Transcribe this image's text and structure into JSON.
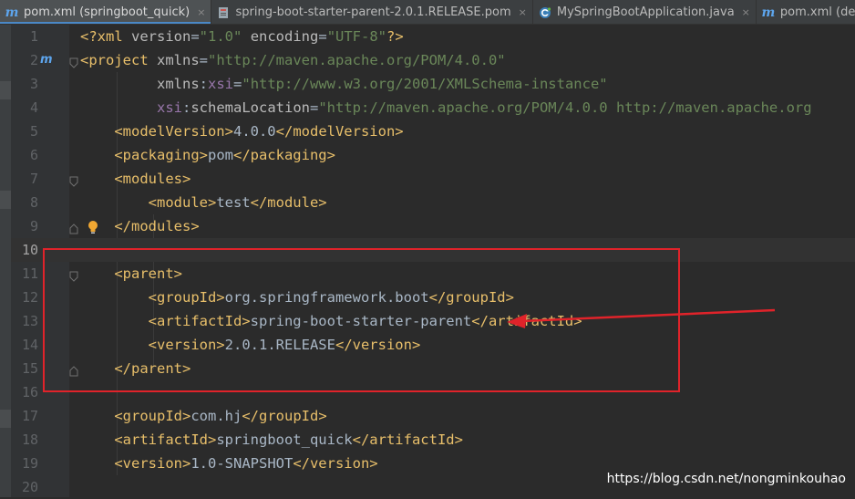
{
  "tabs": [
    {
      "label": "pom.xml (springboot_quick)",
      "icon": "maven-icon",
      "active": true
    },
    {
      "label": "spring-boot-starter-parent-2.0.1.RELEASE.pom",
      "icon": "jar-file-icon",
      "active": false
    },
    {
      "label": "MySpringBootApplication.java",
      "icon": "java-class-icon",
      "active": false
    },
    {
      "label": "pom.xml (demo)",
      "icon": "maven-icon",
      "active": false
    }
  ],
  "tab_close_glyph": "×",
  "gutter": {
    "maven_marker": "m",
    "icons": [
      "maven-icon",
      "fold-icon",
      "lightbulb-icon"
    ]
  },
  "editor": {
    "current_line": 10,
    "lines": [
      {
        "n": "1",
        "tokens": [
          [
            "tag",
            "<?xml "
          ],
          [
            "attr",
            "version"
          ],
          [
            "txt",
            "="
          ],
          [
            "str",
            "\"1.0\""
          ],
          [
            "txt",
            " "
          ],
          [
            "attr",
            "encoding"
          ],
          [
            "txt",
            "="
          ],
          [
            "str",
            "\"UTF-8\""
          ],
          [
            "tag",
            "?>"
          ]
        ]
      },
      {
        "n": "2",
        "tokens": [
          [
            "tag",
            "<project "
          ],
          [
            "attr",
            "xmlns"
          ],
          [
            "txt",
            "="
          ],
          [
            "str",
            "\"http://maven.apache.org/POM/4.0.0\""
          ]
        ]
      },
      {
        "n": "3",
        "tokens": [
          [
            "txt",
            "         "
          ],
          [
            "attr",
            "xmlns"
          ],
          [
            "txt",
            ":"
          ],
          [
            "ns",
            "xsi"
          ],
          [
            "txt",
            "="
          ],
          [
            "str",
            "\"http://www.w3.org/2001/XMLSchema-instance\""
          ]
        ]
      },
      {
        "n": "4",
        "tokens": [
          [
            "txt",
            "         "
          ],
          [
            "ns",
            "xsi"
          ],
          [
            "txt",
            ":"
          ],
          [
            "attr",
            "schemaLocation"
          ],
          [
            "txt",
            "="
          ],
          [
            "str",
            "\"http://maven.apache.org/POM/4.0.0 http://maven.apache.org"
          ]
        ]
      },
      {
        "n": "5",
        "tokens": [
          [
            "txt",
            "    "
          ],
          [
            "tag",
            "<modelVersion>"
          ],
          [
            "txt",
            "4.0.0"
          ],
          [
            "tag",
            "</modelVersion>"
          ]
        ]
      },
      {
        "n": "6",
        "tokens": [
          [
            "txt",
            "    "
          ],
          [
            "tag",
            "<packaging>"
          ],
          [
            "txt",
            "pom"
          ],
          [
            "tag",
            "</packaging>"
          ]
        ]
      },
      {
        "n": "7",
        "tokens": [
          [
            "txt",
            "    "
          ],
          [
            "tag",
            "<modules>"
          ]
        ]
      },
      {
        "n": "8",
        "tokens": [
          [
            "txt",
            "        "
          ],
          [
            "tag",
            "<module>"
          ],
          [
            "txt",
            "test"
          ],
          [
            "tag",
            "</module>"
          ]
        ]
      },
      {
        "n": "9",
        "tokens": [
          [
            "txt",
            "    "
          ],
          [
            "tag",
            "</modules>"
          ]
        ]
      },
      {
        "n": "10",
        "tokens": []
      },
      {
        "n": "11",
        "tokens": [
          [
            "txt",
            "    "
          ],
          [
            "tag",
            "<parent>"
          ]
        ]
      },
      {
        "n": "12",
        "tokens": [
          [
            "txt",
            "        "
          ],
          [
            "tag",
            "<groupId>"
          ],
          [
            "txt",
            "org.springframework.boot"
          ],
          [
            "tag",
            "</groupId>"
          ]
        ]
      },
      {
        "n": "13",
        "tokens": [
          [
            "txt",
            "        "
          ],
          [
            "tag",
            "<artifactId>"
          ],
          [
            "txt",
            "spring-boot-starter-parent"
          ],
          [
            "tag",
            "</artifactId>"
          ]
        ]
      },
      {
        "n": "14",
        "tokens": [
          [
            "txt",
            "        "
          ],
          [
            "tag",
            "<version>"
          ],
          [
            "txt",
            "2.0.1.RELEASE"
          ],
          [
            "tag",
            "</version>"
          ]
        ]
      },
      {
        "n": "15",
        "tokens": [
          [
            "txt",
            "    "
          ],
          [
            "tag",
            "</parent>"
          ]
        ]
      },
      {
        "n": "16",
        "tokens": []
      },
      {
        "n": "17",
        "tokens": [
          [
            "txt",
            "    "
          ],
          [
            "tag",
            "<groupId>"
          ],
          [
            "txt",
            "com.hj"
          ],
          [
            "tag",
            "</groupId>"
          ]
        ]
      },
      {
        "n": "18",
        "tokens": [
          [
            "txt",
            "    "
          ],
          [
            "tag",
            "<artifactId>"
          ],
          [
            "txt",
            "springboot_quick"
          ],
          [
            "tag",
            "</artifactId>"
          ]
        ]
      },
      {
        "n": "19",
        "tokens": [
          [
            "txt",
            "    "
          ],
          [
            "tag",
            "<version>"
          ],
          [
            "txt",
            "1.0-SNAPSHOT"
          ],
          [
            "tag",
            "</version>"
          ]
        ]
      },
      {
        "n": "20",
        "tokens": []
      }
    ]
  },
  "colors": {
    "background": "#2b2b2b",
    "tag": "#e8bf6a",
    "attribute": "#bababa",
    "namespace": "#9876aa",
    "string": "#6a8759",
    "text": "#a9b7c6",
    "annotation_red": "#e0232a",
    "active_tab_underline": "#4a88c7"
  },
  "watermark": "https://blog.csdn.net/nongminkouhao"
}
